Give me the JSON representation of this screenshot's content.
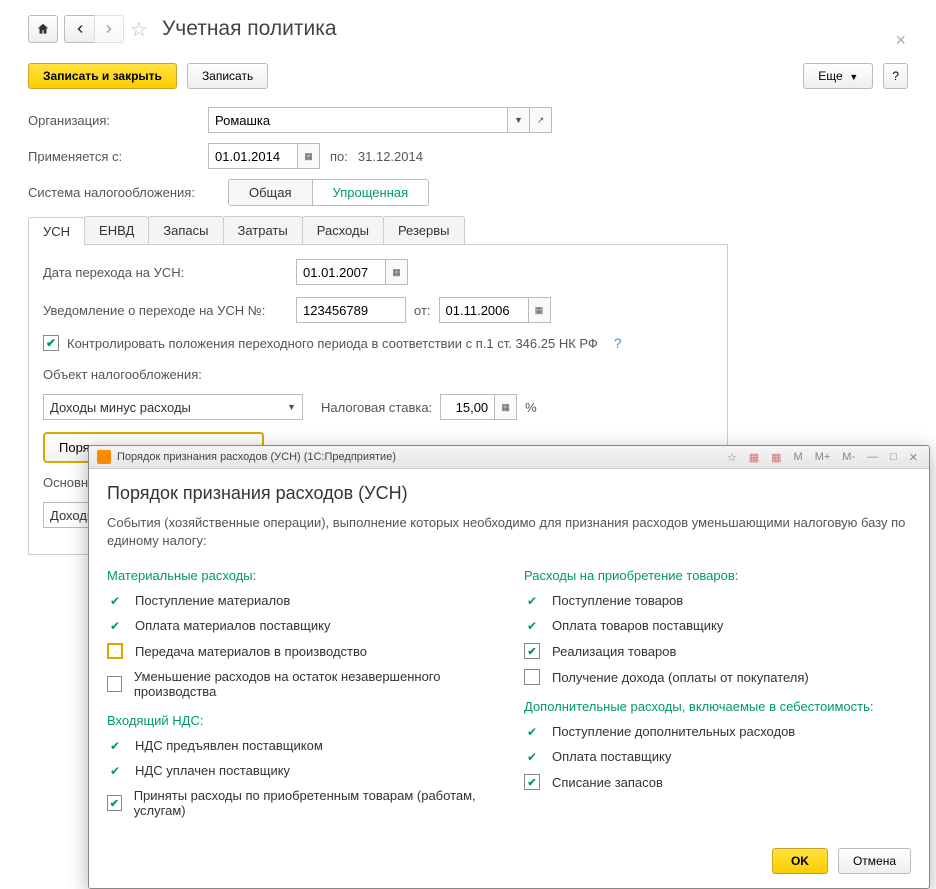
{
  "header": {
    "title": "Учетная политика"
  },
  "commands": {
    "save_close": "Записать и закрыть",
    "save": "Записать",
    "more": "Еще",
    "help": "?"
  },
  "fields": {
    "org_label": "Организация:",
    "org_value": "Ромашка",
    "applied_label": "Применяется с:",
    "applied_from": "01.01.2014",
    "applied_to_label": "по:",
    "applied_to": "31.12.2014",
    "tax_system_label": "Система налогообложения:",
    "tax_general": "Общая",
    "tax_simplified": "Упрощенная"
  },
  "tabs": [
    "УСН",
    "ЕНВД",
    "Запасы",
    "Затраты",
    "Расходы",
    "Резервы"
  ],
  "usn": {
    "transition_date_label": "Дата перехода на УСН:",
    "transition_date": "01.01.2007",
    "notice_label": "Уведомление о переходе на УСН №:",
    "notice_no": "123456789",
    "notice_from_label": "от:",
    "notice_from": "01.11.2006",
    "control_text": "Контролировать положения переходного периода в соответствии с п.1 ст. 346.25 НК РФ",
    "object_label": "Объект налогообложения:",
    "object_value": "Доходы минус расходы",
    "rate_label": "Налоговая ставка:",
    "rate_value": "15,00",
    "rate_percent": "%",
    "order_btn": "Порядок признания расходов...",
    "main_label": "Основной",
    "income_value": "Доходы"
  },
  "dialog": {
    "title": "Порядок признания расходов (УСН) (1С:Предприятие)",
    "heading": "Порядок признания расходов (УСН)",
    "description": "События (хозяйственные операции), выполнение которых необходимо для признания расходов уменьшающими налоговую базу по единому налогу:",
    "sec_material": "Материальные расходы:",
    "mat_items": [
      "Поступление материалов",
      "Оплата материалов поставщику",
      "Передача материалов в производство",
      "Уменьшение расходов на остаток незавершенного производства"
    ],
    "sec_vat": "Входящий НДС:",
    "vat_items": [
      "НДС предъявлен поставщиком",
      "НДС уплачен поставщику",
      "Приняты расходы по приобретенным товарам (работам, услугам)"
    ],
    "sec_goods": "Расходы на приобретение товаров:",
    "goods_items": [
      "Поступление товаров",
      "Оплата товаров поставщику",
      "Реализация товаров",
      "Получение дохода (оплаты от покупателя)"
    ],
    "sec_extra": "Дополнительные расходы, включаемые в себестоимость:",
    "extra_items": [
      "Поступление дополнительных расходов",
      "Оплата поставщику",
      "Списание запасов"
    ],
    "ok": "OK",
    "cancel": "Отмена"
  }
}
